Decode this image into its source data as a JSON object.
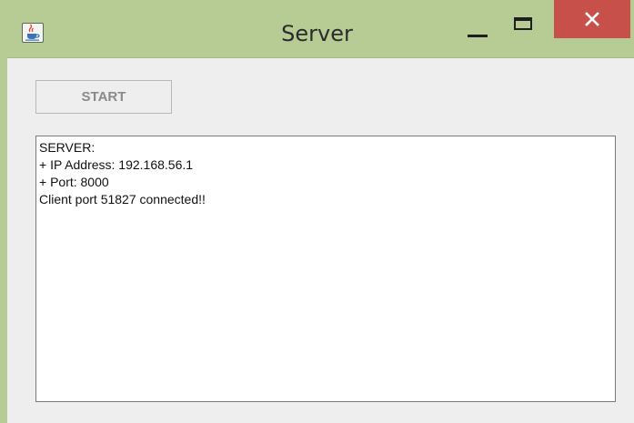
{
  "window": {
    "title": "Server",
    "app_icon": "java-coffee-cup-icon",
    "controls": {
      "minimize_icon": "minimize-icon",
      "maximize_icon": "maximize-icon",
      "close_icon": "close-icon"
    }
  },
  "toolbar": {
    "start_label": "START",
    "start_enabled": false
  },
  "log": {
    "lines": [
      "SERVER:",
      "+ IP Address: 192.168.56.1",
      "+ Port: 8000",
      "Client port 51827 connected!!"
    ]
  },
  "colors": {
    "frame": "#b7cc95",
    "close_button": "#c7504b",
    "client_background": "#eeeeee",
    "disabled_text": "#8a8a8a"
  }
}
